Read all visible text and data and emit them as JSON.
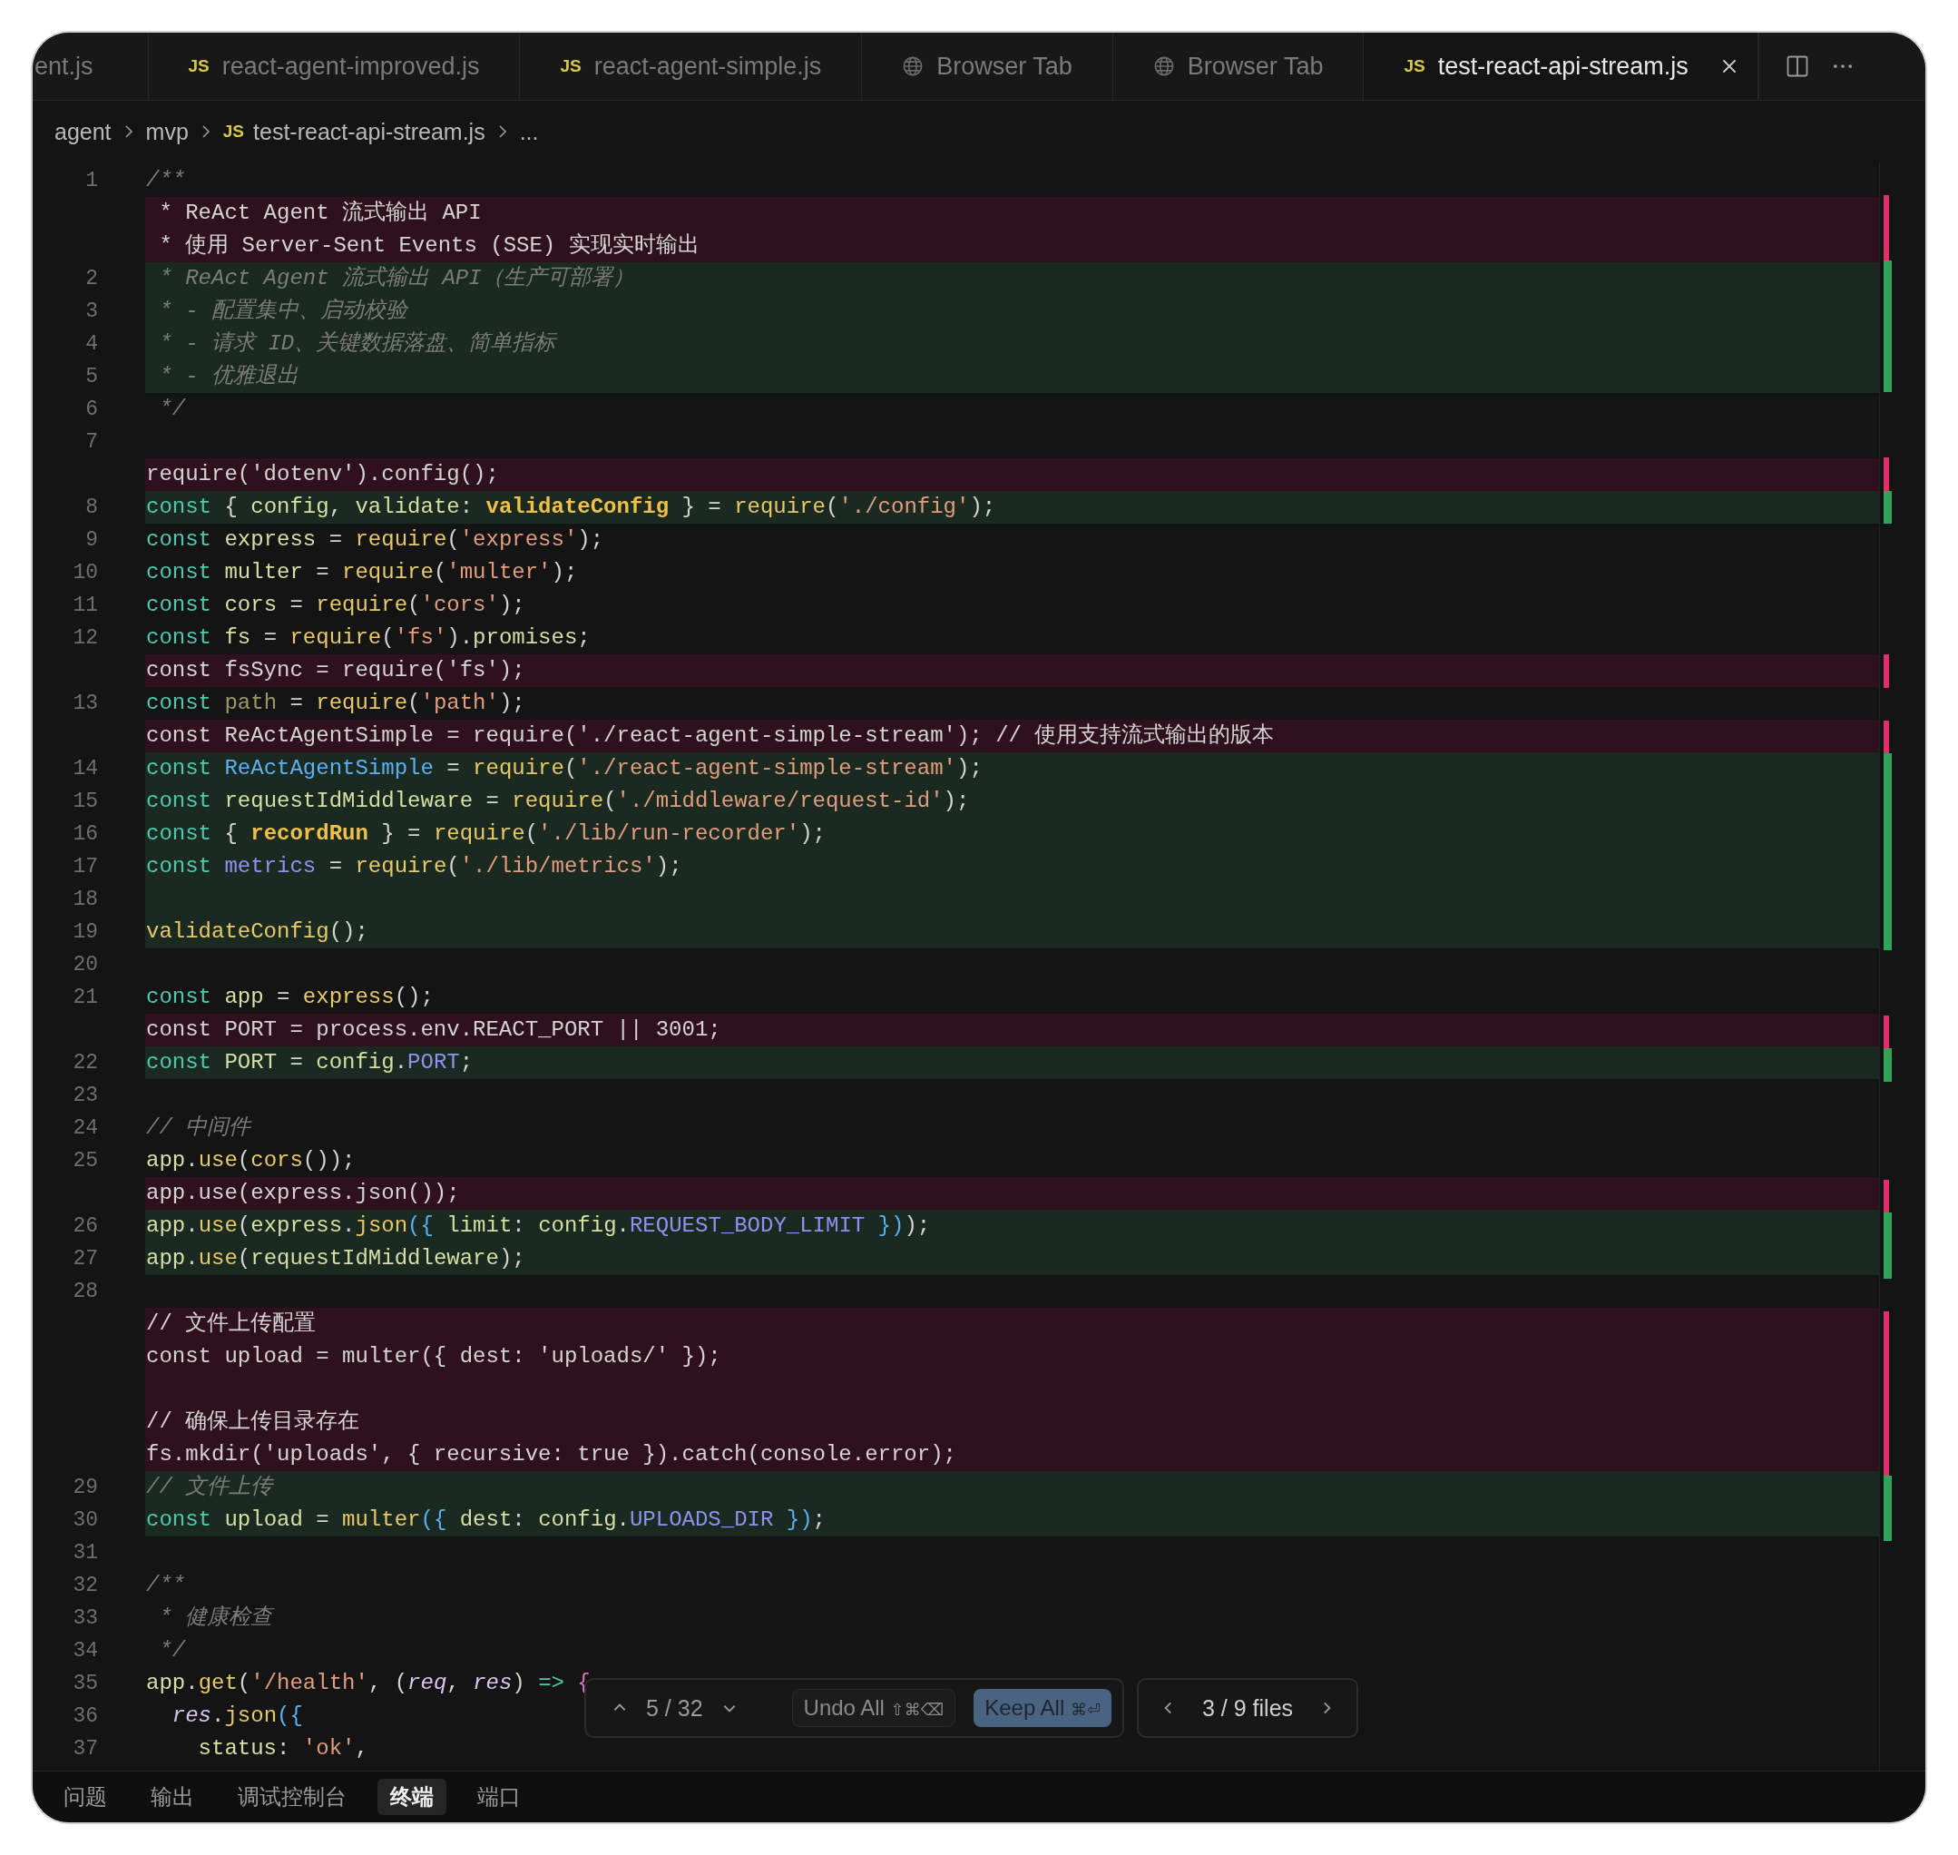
{
  "tabs": [
    {
      "label": "ent.js",
      "kind": "js",
      "selected": false
    },
    {
      "label": "react-agent-improved.js",
      "kind": "js",
      "badge": "JS",
      "selected": false
    },
    {
      "label": "react-agent-simple.js",
      "kind": "js",
      "badge": "JS",
      "selected": false
    },
    {
      "label": "Browser Tab",
      "kind": "web",
      "selected": false
    },
    {
      "label": "Browser Tab",
      "kind": "web",
      "selected": false
    },
    {
      "label": "test-react-api-stream.js",
      "kind": "js",
      "badge": "JS",
      "selected": true
    }
  ],
  "breadcrumb": [
    {
      "label": "agent"
    },
    {
      "label": "mvp"
    },
    {
      "label": "test-react-api-stream.js",
      "badge": "JS"
    },
    {
      "label": "..."
    }
  ],
  "lines": [
    {
      "num": "1",
      "kind": "normal",
      "tokens": [
        {
          "text": "/**",
          "kind": "comment"
        }
      ]
    },
    {
      "kind": "removed",
      "tokens": [
        {
          "text": " * ReAct Agent 流式输出 API",
          "kind": "plain"
        }
      ]
    },
    {
      "kind": "removed",
      "tokens": [
        {
          "text": " * 使用 Server-Sent Events (SSE) 实现实时输出",
          "kind": "plain"
        }
      ]
    },
    {
      "num": "2",
      "kind": "added",
      "tokens": [
        {
          "text": " * ReAct Agent 流式输出 API（生产可部署）",
          "kind": "comment"
        }
      ]
    },
    {
      "num": "3",
      "kind": "added",
      "tokens": [
        {
          "text": " * - 配置集中、启动校验",
          "kind": "comment"
        }
      ]
    },
    {
      "num": "4",
      "kind": "added",
      "tokens": [
        {
          "text": " * - 请求 ID、关键数据落盘、简单指标",
          "kind": "comment"
        }
      ]
    },
    {
      "num": "5",
      "kind": "added",
      "tokens": [
        {
          "text": " * - 优雅退出",
          "kind": "comment"
        }
      ]
    },
    {
      "num": "6",
      "kind": "normal",
      "tokens": [
        {
          "text": " */",
          "kind": "comment"
        }
      ]
    },
    {
      "num": "7",
      "kind": "normal"
    },
    {
      "kind": "removed",
      "tokens": [
        {
          "text": "require('dotenv').config();",
          "kind": "plain"
        }
      ]
    },
    {
      "num": "8",
      "kind": "added",
      "tokens": [
        {
          "text": "const",
          "kind": "kw"
        },
        {
          "text": " { ",
          "kind": "plain"
        },
        {
          "text": "config",
          "kind": "var"
        },
        {
          "text": ", ",
          "kind": "plain"
        },
        {
          "text": "validate",
          "kind": "var"
        },
        {
          "text": ": ",
          "kind": "plain"
        },
        {
          "text": "validateConfig",
          "kind": "bold"
        },
        {
          "text": " } = ",
          "kind": "plain"
        },
        {
          "text": "require",
          "kind": "fn"
        },
        {
          "text": "(",
          "kind": "plain"
        },
        {
          "text": "'./config'",
          "kind": "str"
        },
        {
          "text": ");",
          "kind": "plain"
        }
      ]
    },
    {
      "num": "9",
      "kind": "normal",
      "tokens": [
        {
          "text": "const ",
          "kind": "kw"
        },
        {
          "text": "express",
          "kind": "var"
        },
        {
          "text": " = ",
          "kind": "plain"
        },
        {
          "text": "require",
          "kind": "fn"
        },
        {
          "text": "(",
          "kind": "plain"
        },
        {
          "text": "'express'",
          "kind": "str"
        },
        {
          "text": ");",
          "kind": "plain"
        }
      ]
    },
    {
      "num": "10",
      "kind": "normal",
      "tokens": [
        {
          "text": "const ",
          "kind": "kw"
        },
        {
          "text": "multer",
          "kind": "var"
        },
        {
          "text": " = ",
          "kind": "plain"
        },
        {
          "text": "require",
          "kind": "fn"
        },
        {
          "text": "(",
          "kind": "plain"
        },
        {
          "text": "'multer'",
          "kind": "str"
        },
        {
          "text": ");",
          "kind": "plain"
        }
      ]
    },
    {
      "num": "11",
      "kind": "normal",
      "tokens": [
        {
          "text": "const ",
          "kind": "kw"
        },
        {
          "text": "cors",
          "kind": "var"
        },
        {
          "text": " = ",
          "kind": "plain"
        },
        {
          "text": "require",
          "kind": "fn"
        },
        {
          "text": "(",
          "kind": "plain"
        },
        {
          "text": "'cors'",
          "kind": "str"
        },
        {
          "text": ");",
          "kind": "plain"
        }
      ]
    },
    {
      "num": "12",
      "kind": "normal",
      "tokens": [
        {
          "text": "const ",
          "kind": "kw"
        },
        {
          "text": "fs",
          "kind": "var"
        },
        {
          "text": " = ",
          "kind": "plain"
        },
        {
          "text": "require",
          "kind": "fn"
        },
        {
          "text": "(",
          "kind": "plain"
        },
        {
          "text": "'fs'",
          "kind": "str"
        },
        {
          "text": ").",
          "kind": "plain"
        },
        {
          "text": "promises",
          "kind": "var"
        },
        {
          "text": ";",
          "kind": "plain"
        }
      ]
    },
    {
      "kind": "removed",
      "tokens": [
        {
          "text": "const fsSync = require('fs');",
          "kind": "plain"
        }
      ]
    },
    {
      "num": "13",
      "kind": "normal",
      "tokens": [
        {
          "text": "const ",
          "kind": "kw"
        },
        {
          "text": "path",
          "kind": "dim"
        },
        {
          "text": " = ",
          "kind": "plain"
        },
        {
          "text": "require",
          "kind": "fn"
        },
        {
          "text": "(",
          "kind": "plain"
        },
        {
          "text": "'path'",
          "kind": "str"
        },
        {
          "text": ");",
          "kind": "plain"
        }
      ]
    },
    {
      "kind": "removed",
      "tokens": [
        {
          "text": "const ReActAgentSimple = require('./react-agent-simple-stream'); // 使用支持流式输出的版本",
          "kind": "plain"
        }
      ]
    },
    {
      "num": "14",
      "kind": "added",
      "tokens": [
        {
          "text": "const ",
          "kind": "kw"
        },
        {
          "text": "ReActAgentSimple",
          "kind": "cls"
        },
        {
          "text": " = ",
          "kind": "plain"
        },
        {
          "text": "require",
          "kind": "fn"
        },
        {
          "text": "(",
          "kind": "plain"
        },
        {
          "text": "'./react-agent-simple-stream'",
          "kind": "str"
        },
        {
          "text": ");",
          "kind": "plain"
        }
      ]
    },
    {
      "num": "15",
      "kind": "added",
      "tokens": [
        {
          "text": "const ",
          "kind": "kw"
        },
        {
          "text": "requestIdMiddleware",
          "kind": "var"
        },
        {
          "text": " = ",
          "kind": "plain"
        },
        {
          "text": "require",
          "kind": "fn"
        },
        {
          "text": "(",
          "kind": "plain"
        },
        {
          "text": "'./middleware/request-id'",
          "kind": "str"
        },
        {
          "text": ");",
          "kind": "plain"
        }
      ]
    },
    {
      "num": "16",
      "kind": "added",
      "tokens": [
        {
          "text": "const",
          "kind": "kw"
        },
        {
          "text": " { ",
          "kind": "plain"
        },
        {
          "text": "recordRun",
          "kind": "bold"
        },
        {
          "text": " } = ",
          "kind": "plain"
        },
        {
          "text": "require",
          "kind": "fn"
        },
        {
          "text": "(",
          "kind": "plain"
        },
        {
          "text": "'./lib/run-recorder'",
          "kind": "str"
        },
        {
          "text": ");",
          "kind": "plain"
        }
      ]
    },
    {
      "num": "17",
      "kind": "added",
      "tokens": [
        {
          "text": "const ",
          "kind": "kw"
        },
        {
          "text": "metrics",
          "kind": "cst"
        },
        {
          "text": " = ",
          "kind": "plain"
        },
        {
          "text": "require",
          "kind": "fn"
        },
        {
          "text": "(",
          "kind": "plain"
        },
        {
          "text": "'./lib/metrics'",
          "kind": "str"
        },
        {
          "text": ");",
          "kind": "plain"
        }
      ]
    },
    {
      "num": "18",
      "kind": "added"
    },
    {
      "num": "19",
      "kind": "added",
      "tokens": [
        {
          "text": "validateConfig",
          "kind": "fn"
        },
        {
          "text": "();",
          "kind": "plain"
        }
      ]
    },
    {
      "num": "20",
      "kind": "normal"
    },
    {
      "num": "21",
      "kind": "normal",
      "tokens": [
        {
          "text": "const ",
          "kind": "kw"
        },
        {
          "text": "app",
          "kind": "var"
        },
        {
          "text": " = ",
          "kind": "plain"
        },
        {
          "text": "express",
          "kind": "fn"
        },
        {
          "text": "();",
          "kind": "plain"
        }
      ]
    },
    {
      "kind": "removed",
      "tokens": [
        {
          "text": "const PORT = process.env.REACT_PORT || 3001;",
          "kind": "plain"
        }
      ]
    },
    {
      "num": "22",
      "kind": "added",
      "tokens": [
        {
          "text": "const ",
          "kind": "kw"
        },
        {
          "text": "PORT",
          "kind": "var"
        },
        {
          "text": " = ",
          "kind": "plain"
        },
        {
          "text": "config",
          "kind": "var"
        },
        {
          "text": ".",
          "kind": "plain"
        },
        {
          "text": "PORT",
          "kind": "cst"
        },
        {
          "text": ";",
          "kind": "plain"
        }
      ]
    },
    {
      "num": "23",
      "kind": "normal"
    },
    {
      "num": "24",
      "kind": "normal",
      "tokens": [
        {
          "text": "// 中间件",
          "kind": "comment"
        }
      ]
    },
    {
      "num": "25",
      "kind": "normal",
      "tokens": [
        {
          "text": "app",
          "kind": "var"
        },
        {
          "text": ".",
          "kind": "plain"
        },
        {
          "text": "use",
          "kind": "fn"
        },
        {
          "text": "(",
          "kind": "plain"
        },
        {
          "text": "cors",
          "kind": "fn"
        },
        {
          "text": "());",
          "kind": "plain"
        }
      ]
    },
    {
      "kind": "removed",
      "tokens": [
        {
          "text": "app.use(express.json());",
          "kind": "plain"
        }
      ]
    },
    {
      "num": "26",
      "kind": "added",
      "tokens": [
        {
          "text": "app",
          "kind": "var"
        },
        {
          "text": ".",
          "kind": "plain"
        },
        {
          "text": "use",
          "kind": "fn"
        },
        {
          "text": "(",
          "kind": "plain"
        },
        {
          "text": "express",
          "kind": "var"
        },
        {
          "text": ".",
          "kind": "plain"
        },
        {
          "text": "json",
          "kind": "fn"
        },
        {
          "text": "({ ",
          "kind": "brace"
        },
        {
          "text": "limit",
          "kind": "var"
        },
        {
          "text": ": ",
          "kind": "plain"
        },
        {
          "text": "config",
          "kind": "var"
        },
        {
          "text": ".",
          "kind": "plain"
        },
        {
          "text": "REQUEST_BODY_LIMIT",
          "kind": "cst"
        },
        {
          "text": " })",
          "kind": "brace"
        },
        {
          "text": ");",
          "kind": "plain"
        }
      ]
    },
    {
      "num": "27",
      "kind": "added",
      "tokens": [
        {
          "text": "app",
          "kind": "var"
        },
        {
          "text": ".",
          "kind": "plain"
        },
        {
          "text": "use",
          "kind": "fn"
        },
        {
          "text": "(",
          "kind": "plain"
        },
        {
          "text": "requestIdMiddleware",
          "kind": "var"
        },
        {
          "text": ");",
          "kind": "plain"
        }
      ]
    },
    {
      "num": "28",
      "kind": "normal"
    },
    {
      "kind": "removed",
      "tokens": [
        {
          "text": "// 文件上传配置",
          "kind": "plain"
        }
      ]
    },
    {
      "kind": "removed",
      "tokens": [
        {
          "text": "const upload = multer({ dest: 'uploads/' });",
          "kind": "plain"
        }
      ]
    },
    {
      "kind": "removed"
    },
    {
      "kind": "removed",
      "tokens": [
        {
          "text": "// 确保上传目录存在",
          "kind": "plain"
        }
      ]
    },
    {
      "kind": "removed",
      "tokens": [
        {
          "text": "fs.mkdir('uploads', { recursive: true }).catch(console.error);",
          "kind": "plain"
        }
      ]
    },
    {
      "num": "29",
      "kind": "added",
      "tokens": [
        {
          "text": "// 文件上传",
          "kind": "comment"
        }
      ]
    },
    {
      "num": "30",
      "kind": "added",
      "tokens": [
        {
          "text": "const ",
          "kind": "kw"
        },
        {
          "text": "upload",
          "kind": "var"
        },
        {
          "text": " = ",
          "kind": "plain"
        },
        {
          "text": "multer",
          "kind": "fn"
        },
        {
          "text": "({ ",
          "kind": "brace"
        },
        {
          "text": "dest",
          "kind": "var"
        },
        {
          "text": ": ",
          "kind": "plain"
        },
        {
          "text": "config",
          "kind": "var"
        },
        {
          "text": ".",
          "kind": "plain"
        },
        {
          "text": "UPLOADS_DIR",
          "kind": "cst"
        },
        {
          "text": " })",
          "kind": "brace"
        },
        {
          "text": ";",
          "kind": "plain"
        }
      ]
    },
    {
      "num": "31",
      "kind": "normal"
    },
    {
      "num": "32",
      "kind": "normal",
      "tokens": [
        {
          "text": "/**",
          "kind": "comment"
        }
      ]
    },
    {
      "num": "33",
      "kind": "normal",
      "tokens": [
        {
          "text": " * 健康检查",
          "kind": "comment"
        }
      ]
    },
    {
      "num": "34",
      "kind": "normal",
      "tokens": [
        {
          "text": " */",
          "kind": "comment"
        }
      ]
    },
    {
      "num": "35",
      "kind": "normal",
      "tokens": [
        {
          "text": "app",
          "kind": "var"
        },
        {
          "text": ".",
          "kind": "plain"
        },
        {
          "text": "get",
          "kind": "fn"
        },
        {
          "text": "(",
          "kind": "plain"
        },
        {
          "text": "'/health'",
          "kind": "str"
        },
        {
          "text": ", (",
          "kind": "plain"
        },
        {
          "text": "req",
          "kind": "param"
        },
        {
          "text": ", ",
          "kind": "plain"
        },
        {
          "text": "res",
          "kind": "param"
        },
        {
          "text": ") ",
          "kind": "plain"
        },
        {
          "text": "=>",
          "kind": "kw"
        },
        {
          "text": " {",
          "kind": "pink"
        }
      ]
    },
    {
      "num": "36",
      "kind": "normal",
      "tokens": [
        {
          "text": "  res",
          "kind": "param"
        },
        {
          "text": ".",
          "kind": "plain"
        },
        {
          "text": "json",
          "kind": "fn"
        },
        {
          "text": "({",
          "kind": "brace"
        }
      ]
    },
    {
      "num": "37",
      "kind": "normal",
      "tokens": [
        {
          "text": "    status",
          "kind": "var"
        },
        {
          "text": ": ",
          "kind": "plain"
        },
        {
          "text": "'ok'",
          "kind": "str"
        },
        {
          "text": ",",
          "kind": "plain"
        }
      ]
    }
  ],
  "review_bar": {
    "position": "5 / 32",
    "undo_label": "Undo All",
    "undo_shortcut": "⇧⌘⌫",
    "keep_label": "Keep All",
    "keep_shortcut": "⌘⏎",
    "files": "3 / 9 files"
  },
  "panel_tabs": [
    {
      "label": "问题",
      "selected": false
    },
    {
      "label": "输出",
      "selected": false
    },
    {
      "label": "调试控制台",
      "selected": false
    },
    {
      "label": "终端",
      "selected": true
    },
    {
      "label": "端口",
      "selected": false
    }
  ]
}
